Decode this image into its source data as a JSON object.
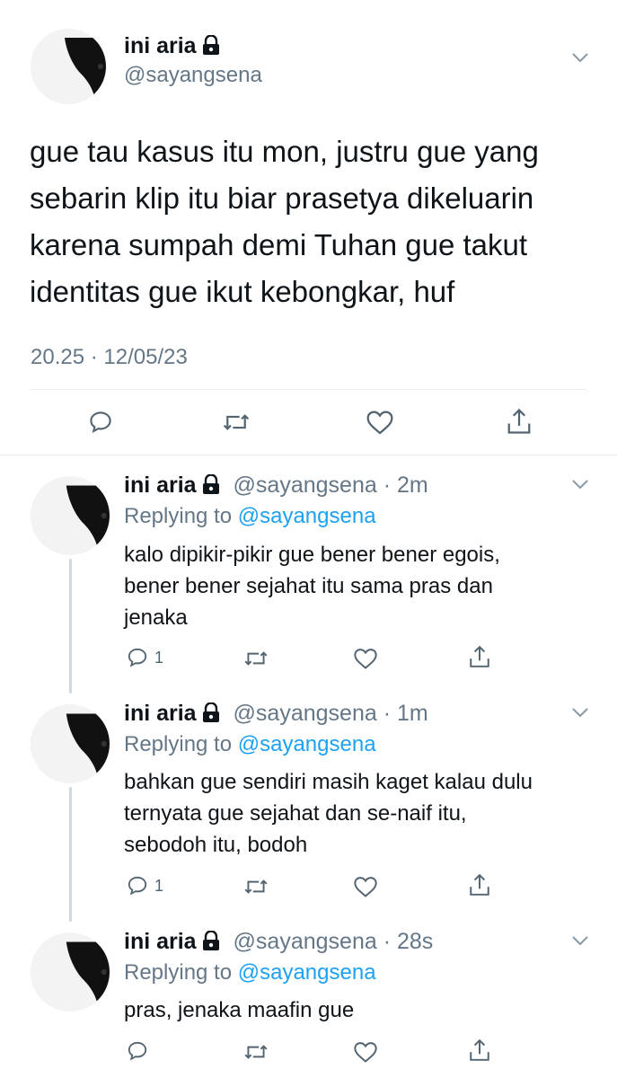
{
  "main_tweet": {
    "display_name": "ini aria",
    "handle": "@sayangsena",
    "text_lines": [
      "gue tau kasus itu mon, justru gue yang",
      "sebarin klip itu biar prasetya dikeluarin",
      "karena sumpah demi Tuhan gue takut",
      "identitas gue ikut kebongkar, huf"
    ],
    "timestamp": "20.25 · 12/05/23",
    "icons": [
      "reply-icon",
      "retweet-icon",
      "like-icon",
      "share-icon"
    ]
  },
  "replies": [
    {
      "display_name": "ini aria",
      "handle": "@sayangsena",
      "time": "· 2m",
      "replying_to_label": "Replying to",
      "replying_to_handle": "@sayangsena",
      "text_lines": [
        "kalo dipikir-pikir gue bener bener egois,",
        "bener bener sejahat itu sama pras dan",
        "jenaka"
      ],
      "reply_count": "1"
    },
    {
      "display_name": "ini aria",
      "handle": "@sayangsena",
      "time": "· 1m",
      "replying_to_label": "Replying to",
      "replying_to_handle": "@sayangsena",
      "text_lines": [
        "bahkan gue sendiri masih kaget kalau dulu",
        "ternyata gue sejahat dan se-naif itu,",
        "sebodoh itu, bodoh"
      ],
      "reply_count": "1"
    },
    {
      "display_name": "ini aria",
      "handle": "@sayangsena",
      "time": "· 28s",
      "replying_to_label": "Replying to",
      "replying_to_handle": "@sayangsena",
      "text_lines": [
        "pras, jenaka maafin gue"
      ],
      "reply_count": ""
    }
  ],
  "colors": {
    "link_blue": "#1da1f2",
    "secondary_grey": "#657786",
    "divider": "#e6ecf0"
  }
}
